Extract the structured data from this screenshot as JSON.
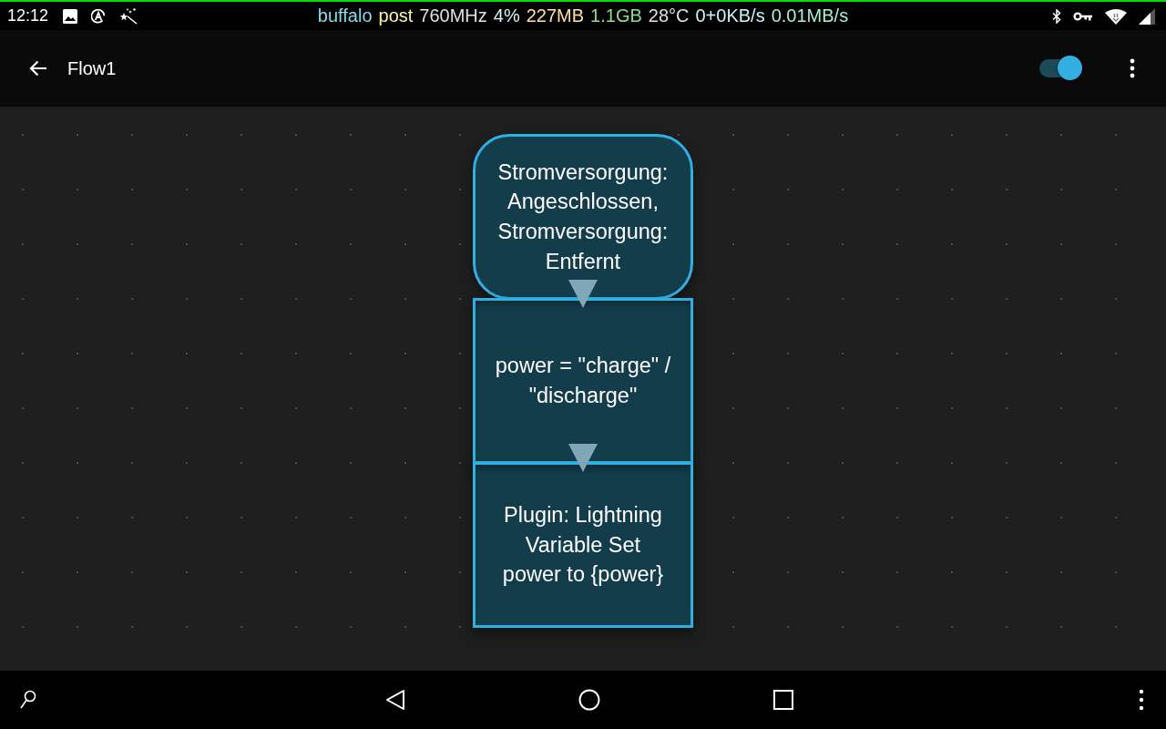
{
  "status_bar": {
    "time": "12:12",
    "stats": [
      {
        "text": "buffalo",
        "color": "#80deea"
      },
      {
        "text": "post",
        "color": "#fff59d"
      },
      {
        "text": "760MHz",
        "color": "#e0e0e0"
      },
      {
        "text": "4%",
        "color": "#d4f4f4"
      },
      {
        "text": "227MB",
        "color": "#ffe0a0"
      },
      {
        "text": "1.1GB",
        "color": "#8fdc8f"
      },
      {
        "text": "28°C",
        "color": "#e0e0e0"
      },
      {
        "text": "0+0KB/s",
        "color": "#c8f4fa"
      },
      {
        "text": "0.01MB/s",
        "color": "#a8f0d0"
      }
    ]
  },
  "toolbar": {
    "title": "Flow1",
    "enabled": true
  },
  "flow": {
    "nodes": [
      {
        "kind": "trigger",
        "lines": [
          "Stromversorgung:",
          "Angeschlossen,",
          "Stromversorgung:",
          "Entfernt"
        ]
      },
      {
        "kind": "variable",
        "lines": [
          "power = \"charge\" /",
          "\"discharge\""
        ]
      },
      {
        "kind": "action",
        "lines": [
          "Plugin: Lightning",
          "Variable Set",
          "power to {power}"
        ]
      }
    ]
  }
}
